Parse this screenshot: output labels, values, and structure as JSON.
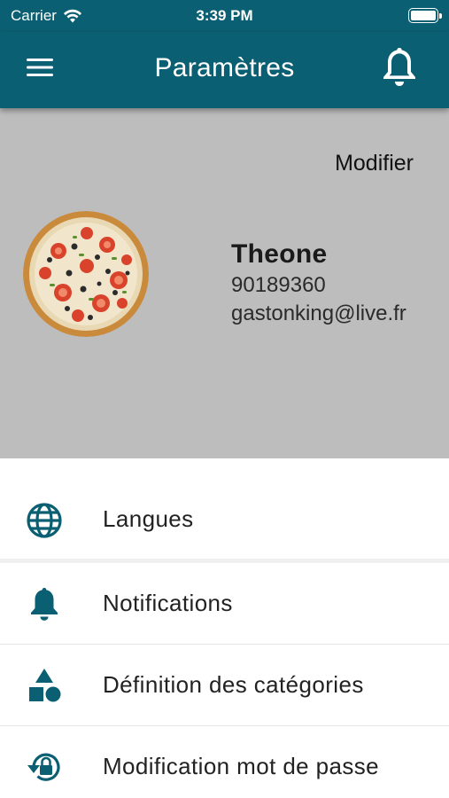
{
  "status_bar": {
    "carrier": "Carrier",
    "time": "3:39 PM",
    "icons": [
      "wifi-icon",
      "battery-icon"
    ]
  },
  "app_bar": {
    "title": "Paramètres",
    "menu_icon": "hamburger-menu-icon",
    "notification_icon": "bell-icon"
  },
  "profile": {
    "edit_label": "Modifier",
    "avatar": "pizza-photo",
    "name": "Theone",
    "phone": "90189360",
    "email": "gastonking@live.fr"
  },
  "settings_menu": {
    "items": [
      {
        "label": "Langues",
        "icon": "globe-icon"
      },
      {
        "label": "Notifications",
        "icon": "bell-icon"
      },
      {
        "label": "Définition des catégories",
        "icon": "shapes-icon"
      },
      {
        "label": "Modification mot de passe",
        "icon": "lock-reset-icon"
      }
    ]
  },
  "colors": {
    "primary": "#0b5f72",
    "profile_background": "#bdbdbd",
    "list_background": "#ffffff"
  }
}
